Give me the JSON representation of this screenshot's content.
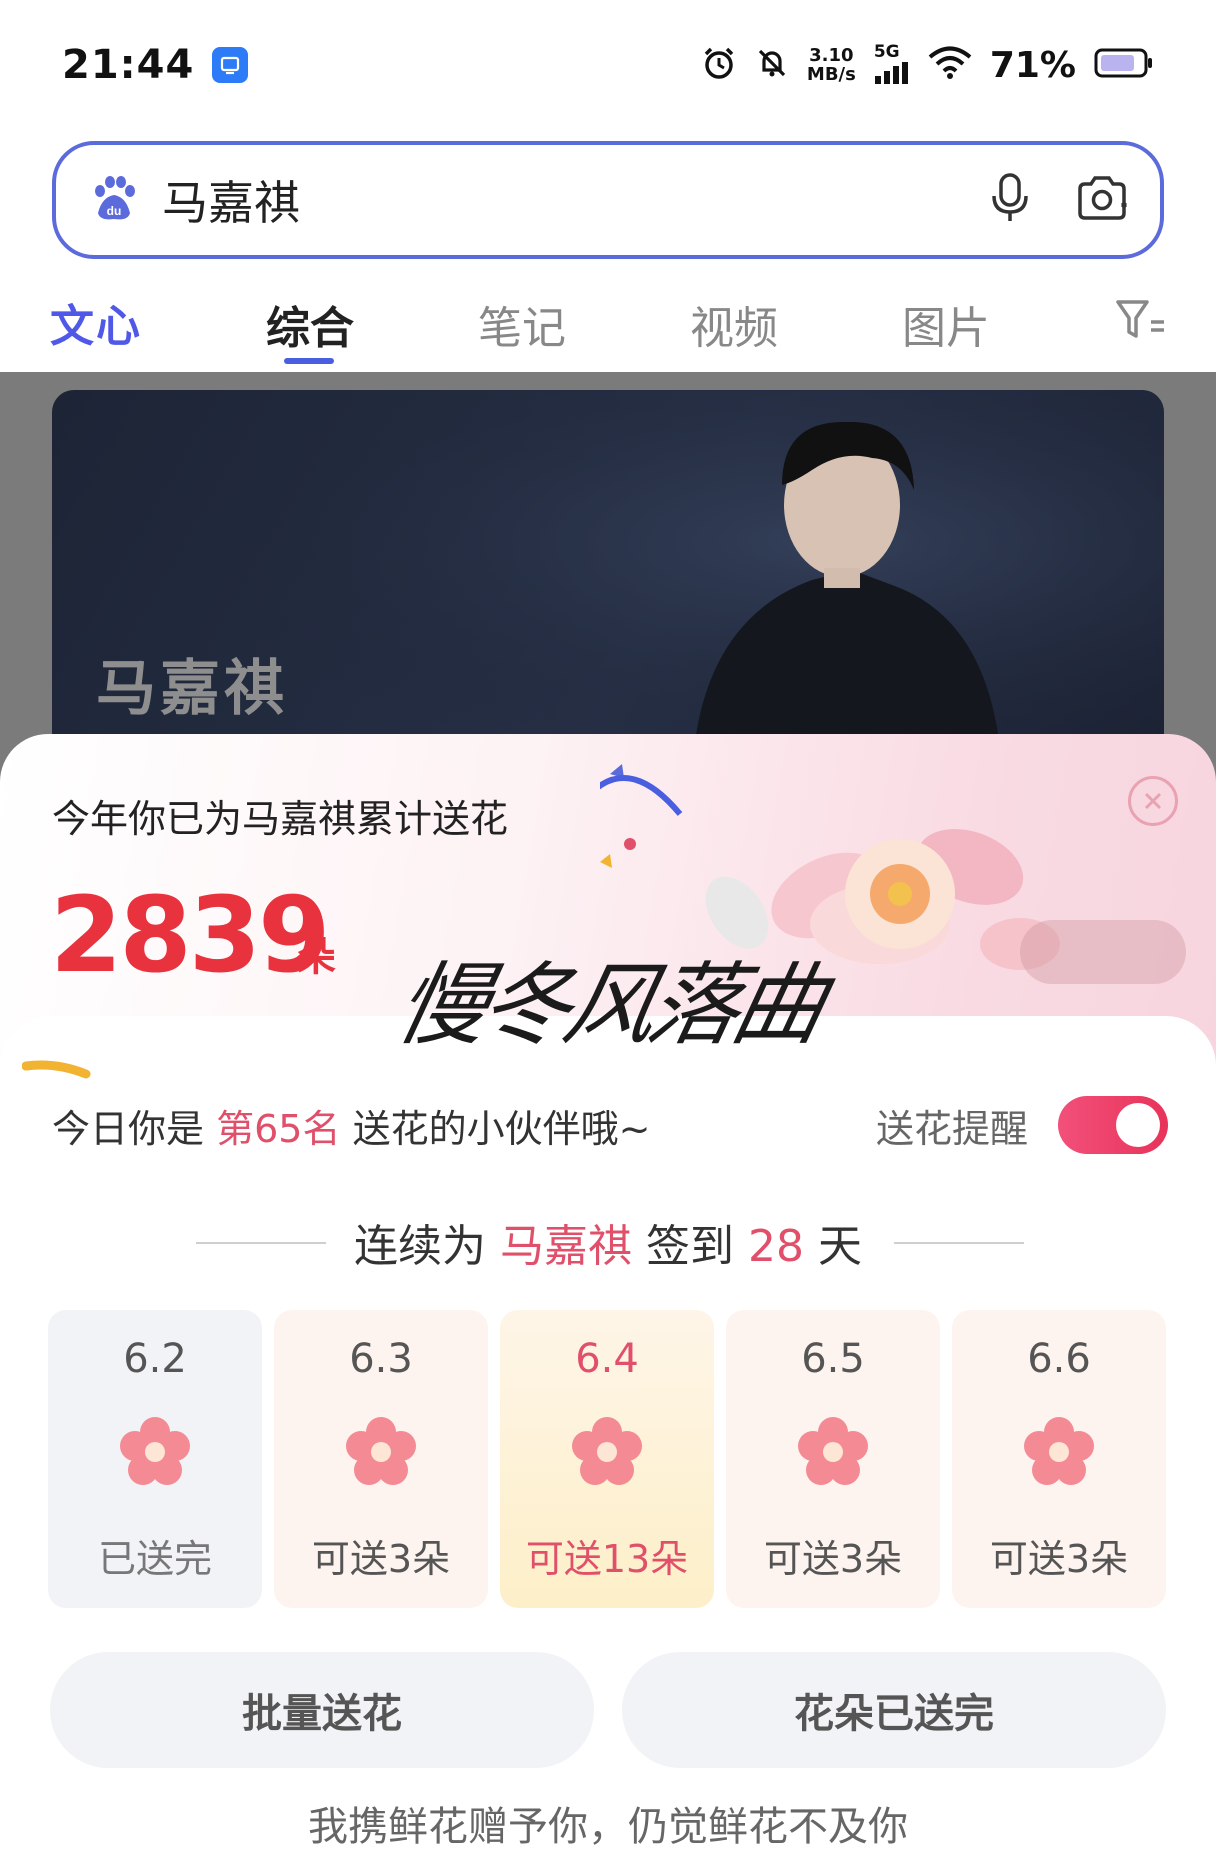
{
  "status_bar": {
    "time": "21:44",
    "net_speed_value": "3.10",
    "net_speed_unit": "MB/s",
    "network_type": "5G",
    "battery_percent": "71%"
  },
  "search": {
    "query": "马嘉祺"
  },
  "tabs": {
    "wenxin": "文心",
    "items": [
      {
        "label": "综合",
        "active": true
      },
      {
        "label": "笔记",
        "active": false
      },
      {
        "label": "视频",
        "active": false
      },
      {
        "label": "图片",
        "active": false
      }
    ]
  },
  "hero": {
    "name": "马嘉祺"
  },
  "flower_panel": {
    "title": "今年你已为马嘉祺累计送花",
    "total_count": "2839",
    "count_unit": "朵",
    "calligraphy": "慢冬风落曲",
    "rank_prefix": "今日你是",
    "rank_value": "第65名",
    "rank_suffix": "送花的小伙伴哦~",
    "reminder_label": "送花提醒",
    "reminder_on": true,
    "streak_prefix": "连续为",
    "streak_name": "马嘉祺",
    "streak_mid": "签到",
    "streak_days": "28",
    "streak_suffix": "天",
    "days": [
      {
        "date": "6.2",
        "status": "已送完"
      },
      {
        "date": "6.3",
        "status": "可送3朵"
      },
      {
        "date": "6.4",
        "status": "可送13朵"
      },
      {
        "date": "6.5",
        "status": "可送3朵"
      },
      {
        "date": "6.6",
        "status": "可送3朵"
      }
    ],
    "batch_button": "批量送花",
    "done_button": "花朵已送完",
    "quote": "我携鲜花赠予你，仍觉鲜花不及你"
  },
  "colors": {
    "accent_blue": "#5b6bdc",
    "count_red": "#e8333f",
    "highlight_pink": "#e0506a"
  }
}
